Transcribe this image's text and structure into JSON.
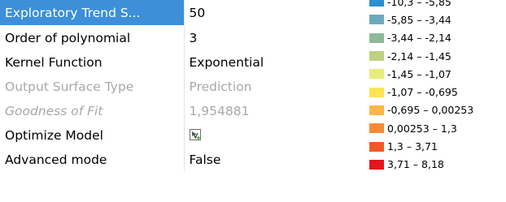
{
  "properties": [
    {
      "name": "Exploratory Trend S...",
      "value": "50",
      "state": "selected"
    },
    {
      "name": "Order of polynomial",
      "value": "3",
      "state": "normal"
    },
    {
      "name": "Kernel Function",
      "value": "Exponential",
      "state": "normal"
    },
    {
      "name": "Output Surface Type",
      "value": "Prediction",
      "state": "disabled"
    },
    {
      "name": "Goodness of Fit",
      "value": "1,954881",
      "state": "disabled-italic"
    },
    {
      "name": "Optimize Model",
      "value": "",
      "value_icon": "optimize-model-icon",
      "state": "normal"
    },
    {
      "name": "Advanced mode",
      "value": "False",
      "state": "normal"
    }
  ],
  "legend": {
    "items": [
      {
        "label": "-10,3 – -5,85",
        "color": "#2b8fd0"
      },
      {
        "label": "-5,85 – -3,44",
        "color": "#6ea8be"
      },
      {
        "label": "-3,44 – -2,14",
        "color": "#8dba9b"
      },
      {
        "label": "-2,14 – -1,45",
        "color": "#bcd181"
      },
      {
        "label": "-1,45 – -1,07",
        "color": "#e8ec7a"
      },
      {
        "label": "-1,07 – -0,695",
        "color": "#fde456"
      },
      {
        "label": "-0,695 – 0,00253",
        "color": "#fdb548"
      },
      {
        "label": "0,00253 – 1,3",
        "color": "#f98a35"
      },
      {
        "label": "1,3 – 3,71",
        "color": "#f15a25"
      },
      {
        "label": "3,71 – 8,18",
        "color": "#e3161b"
      }
    ]
  }
}
